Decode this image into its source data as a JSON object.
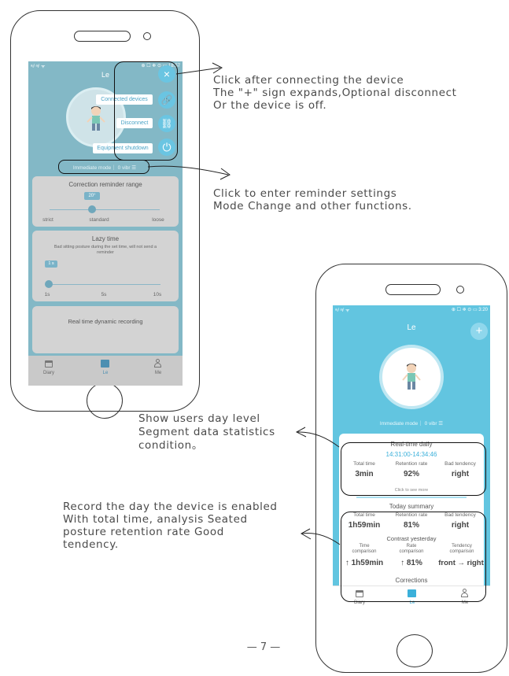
{
  "left_phone": {
    "status_left": "ᵃıˡ ᵃıˡ ᯤ",
    "status_right": "⊕ ☐ ❄ ⊙ ▭ 18:57",
    "title": "Le",
    "menu": {
      "connected_devices": "Connected devices",
      "disconnect": "Disconnect",
      "equipment_shutdown": "Equipment shutdown"
    },
    "mode": "Immediate mode｜ 0 vibr ☰",
    "correction": {
      "title": "Correction reminder range",
      "value": "20°",
      "options": [
        "strict",
        "standard",
        "loose"
      ]
    },
    "lazy": {
      "title": "Lazy time",
      "desc": "Bad sitting posture during the set time, will not send a reminder",
      "value": "1 s",
      "ticks": [
        "1s",
        "5s",
        "10s"
      ]
    },
    "realtime_title": "Real time dynamic recording",
    "nav": [
      "Diary",
      "Le",
      "Me"
    ]
  },
  "right_phone": {
    "status_left": "ᵃıˡ ᵃıˡ ᯤ",
    "status_right": "⊕ ☐ ❄ ⊙ ▭ 3:20",
    "title": "Le",
    "mode": "Immediate mode｜ 0 vibr ☰",
    "daily": {
      "title": "Real-time daily",
      "range": "14:31:00-14:34:46",
      "headers": [
        "Total time",
        "Retention rate",
        "Bad tendency"
      ],
      "values": [
        "3min",
        "92%",
        "right"
      ]
    },
    "see_more": "Click to see more",
    "summary": {
      "title": "Today summary",
      "headers": [
        "Total time",
        "Retention rate",
        "Bad tendency"
      ],
      "values": [
        "1h59min",
        "81%",
        "right"
      ]
    },
    "contrast": {
      "title": "Contrast yesterday",
      "headers": [
        "Time comparison",
        "Rate comparison",
        "Tendency comparison"
      ],
      "values": [
        "↑ 1h59min",
        "↑ 81%",
        "front → right"
      ]
    },
    "corrections": "Corrections",
    "nav": [
      "Diary",
      "Le",
      "Me"
    ]
  },
  "notes": {
    "connect": [
      "Click after connecting the device",
      "The \"+\" sign expands,Optional disconnect",
      "Or the device is off."
    ],
    "reminder": [
      "Click to enter reminder settings",
      "Mode Change and other functions."
    ],
    "day_level": [
      "Show users day level",
      "Segment data statistics",
      "condition。"
    ],
    "record": [
      "Record the day the device is enabled",
      "With total time, analysis Seated",
      "posture retention rate Good",
      "tendency."
    ]
  },
  "page_number": "— 7 —",
  "colors": {
    "teal": "#5fc3df",
    "teal_light": "#a9e1ef",
    "overlay": "#7fb2bf",
    "blue_text": "#2fa9d6",
    "icon_blue": "#6ac5e2"
  }
}
